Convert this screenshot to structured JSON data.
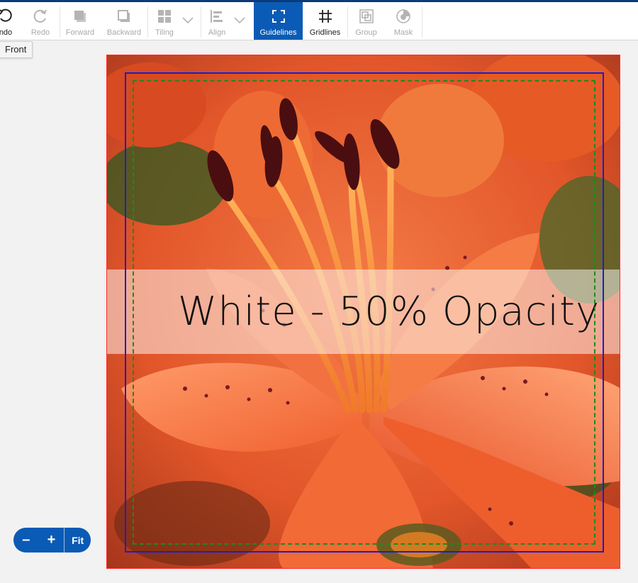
{
  "toolbar": {
    "undo": "ndo",
    "redo": "Redo",
    "forward": "Forward",
    "backward": "Backward",
    "tiling": "Tiling",
    "align": "Align",
    "guidelines": "Guidelines",
    "gridlines": "Gridlines",
    "group": "Group",
    "mask": "Mask"
  },
  "tooltip": "Front",
  "canvas": {
    "overlay_text": "White - 50% Opacity",
    "overlay_color": "#ffffff",
    "overlay_opacity": 0.5
  },
  "zoom": {
    "minus": "–",
    "plus": "+",
    "fit": "Fit"
  },
  "colors": {
    "accent": "#0a5bb5",
    "canvas_border": "#ff2a2a",
    "guideline_blue": "#1d1dcc",
    "safe_area_green": "#1e8a1e"
  }
}
